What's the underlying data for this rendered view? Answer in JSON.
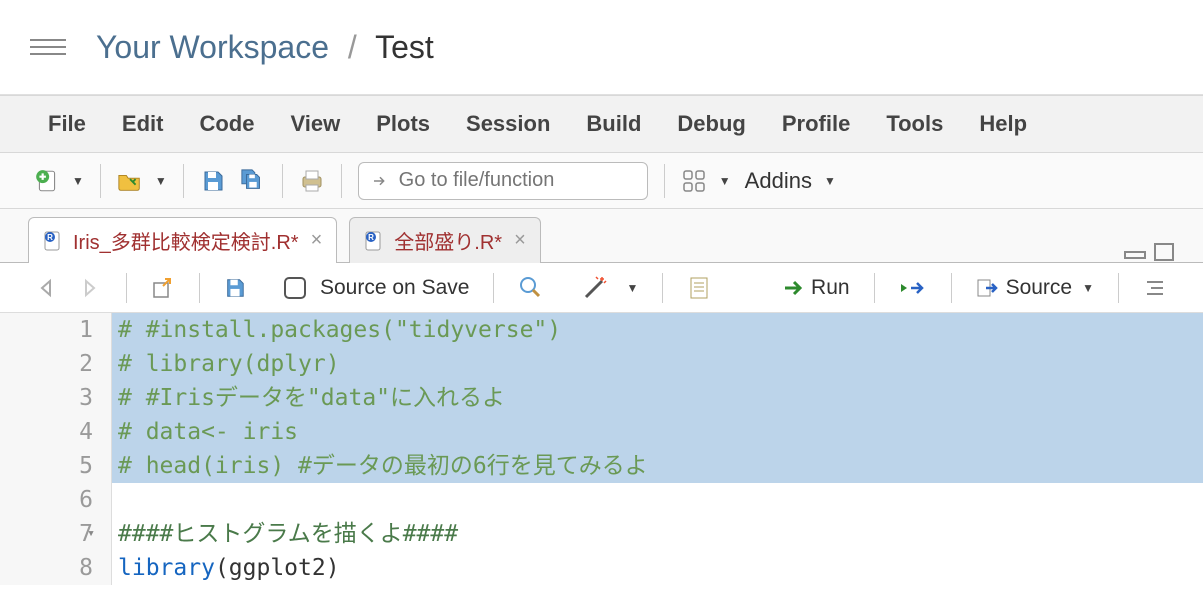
{
  "breadcrumb": {
    "workspace": "Your Workspace",
    "project": "Test"
  },
  "menu": [
    "File",
    "Edit",
    "Code",
    "View",
    "Plots",
    "Session",
    "Build",
    "Debug",
    "Profile",
    "Tools",
    "Help"
  ],
  "toolbar": {
    "search_placeholder": "Go to file/function",
    "addins": "Addins"
  },
  "tabs": [
    {
      "label": "Iris_多群比較検定検討.R*",
      "active": true
    },
    {
      "label": "全部盛り.R*",
      "active": false
    }
  ],
  "editor_toolbar": {
    "source_on_save": "Source on Save",
    "run": "Run",
    "source": "Source"
  },
  "code_lines": [
    {
      "n": 1,
      "text": "# #install.packages(\"tidyverse\")",
      "hl": true,
      "cls": "cmt"
    },
    {
      "n": 2,
      "text": "# library(dplyr)",
      "hl": true,
      "cls": "cmt"
    },
    {
      "n": 3,
      "text": "# #Irisデータを\"data\"に入れるよ",
      "hl": true,
      "cls": "cmt"
    },
    {
      "n": 4,
      "text": "# data<- iris",
      "hl": true,
      "cls": "cmt"
    },
    {
      "n": 5,
      "text": "# head(iris) #データの最初の6行を見てみるよ",
      "hl": true,
      "cls": "cmt"
    },
    {
      "n": 6,
      "text": "",
      "hl": false,
      "cls": ""
    },
    {
      "n": 7,
      "text": "####ヒストグラムを描くよ####",
      "hl": false,
      "cls": "cmt2",
      "fold": true
    },
    {
      "n": 8,
      "text": "library(ggplot2)",
      "hl": false,
      "cls": "code"
    }
  ]
}
